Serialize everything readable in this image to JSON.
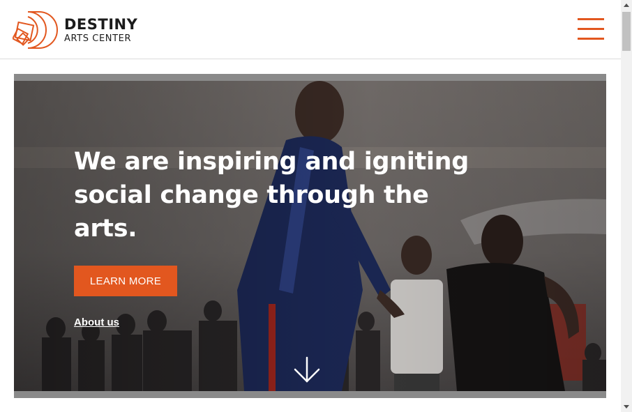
{
  "brand": {
    "name": "DESTINY",
    "subtitle": "ARTS CENTER",
    "logo_icon": "spiral-d-logo-icon",
    "accent_color": "#e2571f"
  },
  "header": {
    "menu_icon": "hamburger-menu-icon"
  },
  "hero": {
    "headline": "We are inspiring and igniting social change through the arts.",
    "cta_label": "LEARN MORE",
    "about_link": "About us",
    "scroll_icon": "arrow-down-icon",
    "background": "photo of dancers in a studio"
  }
}
